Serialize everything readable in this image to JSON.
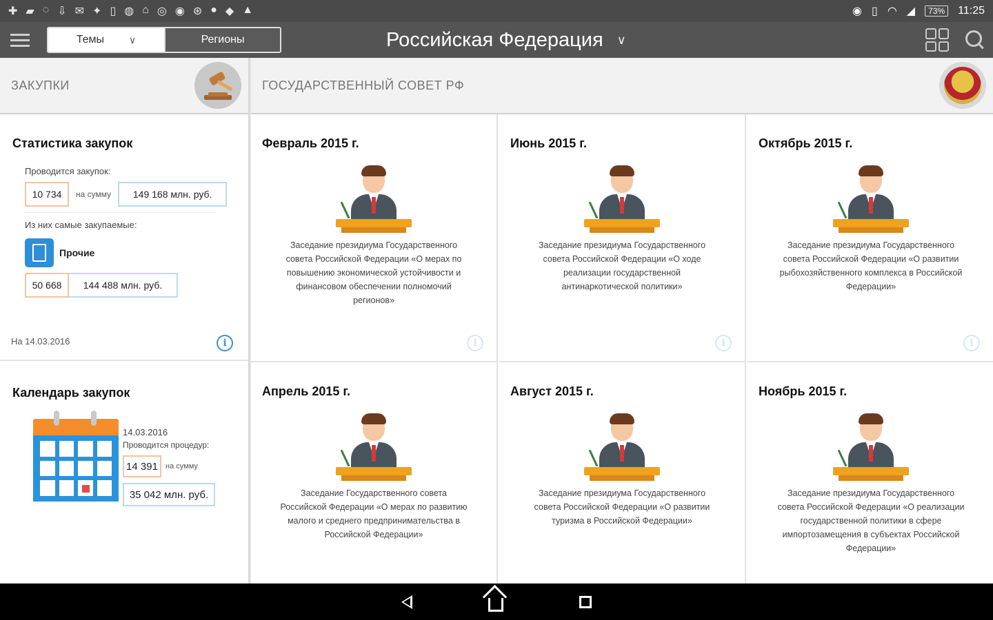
{
  "status_bar": {
    "battery": "73%",
    "time": "11:25"
  },
  "toolbar": {
    "tab_topics": "Темы",
    "tab_regions": "Регионы",
    "region_title": "Российская Федерация"
  },
  "procurement": {
    "section_title": "ЗАКУПКИ",
    "stats": {
      "title": "Статистика закупок",
      "ongoing_label": "Проводится закупок:",
      "ongoing_count": "10 734",
      "for_sum_label": "на сумму",
      "ongoing_sum": "149 168 млн. руб.",
      "top_label": "Из них самые закупаемые:",
      "top_category": "Прочие",
      "top_count": "50 668",
      "top_sum": "144 488 млн. руб.",
      "date": "На 14.03.2016"
    },
    "calendar": {
      "title": "Календарь закупок",
      "date": "14.03.2016",
      "label": "Проводится процедур:",
      "count": "14 391",
      "for_sum_label": "на сумму",
      "sum": "35 042 млн. руб."
    }
  },
  "state_council": {
    "section_title": "ГОСУДАРСТВЕННЫЙ СОВЕТ РФ",
    "months": [
      {
        "title": "Февраль 2015 г.",
        "desc": "Заседание президиума Государственного совета Российской Федерации «О мерах по повышению экономической устойчивости и финансовом обеспечении полномочий регионов»"
      },
      {
        "title": "Июнь 2015 г.",
        "desc": "Заседание президиума Государственного совета Российской Федерации «О ходе реализации государственной антинаркотической политики»"
      },
      {
        "title": "Октябрь 2015 г.",
        "desc": "Заседание президиума Государственного совета Российской Федерации «О развитии рыбохозяйственного комплекса в Российской Федерации»"
      },
      {
        "title": "Апрель 2015 г.",
        "desc": "Заседание Государственного совета Российской Федерации «О мерах по развитию малого и среднего предпринимательства в Российской Федерации»"
      },
      {
        "title": "Август 2015 г.",
        "desc": "Заседание президиума Государственного совета Российской Федерации «О развитии туризма в Российской Федерации»"
      },
      {
        "title": "Ноябрь 2015 г.",
        "desc": "Заседание президиума Государственного совета Российской Федерации «О реализации государственной политики в сфере импортозамещения в субъектах Российской Федерации»"
      }
    ]
  },
  "icons": {
    "info": "i"
  }
}
